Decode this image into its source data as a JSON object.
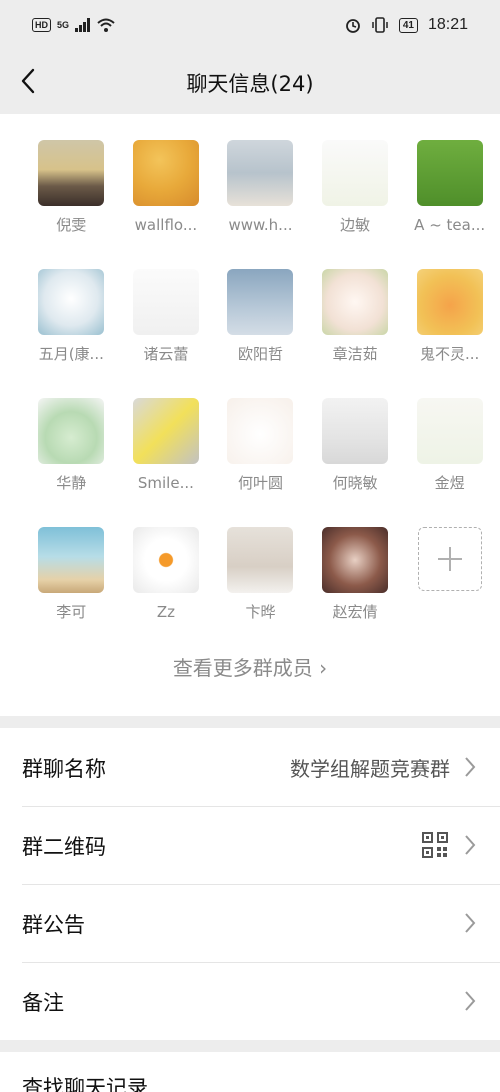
{
  "status_bar": {
    "hd": "HD",
    "network": "5G",
    "battery": "41",
    "time": "18:21"
  },
  "nav": {
    "title": "聊天信息(24)"
  },
  "members": [
    {
      "name": "倪雯",
      "avatar": "photo-window"
    },
    {
      "name": "wallflo...",
      "avatar": "little-prince"
    },
    {
      "name": "www.h...",
      "avatar": "beach-girl"
    },
    {
      "name": "边敏",
      "avatar": "sketch-girl"
    },
    {
      "name": "A ~ tea...",
      "avatar": "grass"
    },
    {
      "name": "五月(康...",
      "avatar": "cat-doll"
    },
    {
      "name": "诸云蕾",
      "avatar": "cloud-im-ok"
    },
    {
      "name": "欧阳哲",
      "avatar": "sky"
    },
    {
      "name": "章洁茹",
      "avatar": "couple-cartoon"
    },
    {
      "name": "鬼不灵...",
      "avatar": "tiger"
    },
    {
      "name": "华静",
      "avatar": "santa-cartoon"
    },
    {
      "name": "Smile...",
      "avatar": "cat-toy"
    },
    {
      "name": "何叶圆",
      "avatar": "girl-cartoon"
    },
    {
      "name": "何晓敏",
      "avatar": "child-photo"
    },
    {
      "name": "金煜",
      "avatar": "little-girl"
    },
    {
      "name": "李可",
      "avatar": "road-girl"
    },
    {
      "name": "Zz",
      "avatar": "egg"
    },
    {
      "name": "卞晔",
      "avatar": "boy-photo"
    },
    {
      "name": "赵宏倩",
      "avatar": "anime-girl"
    }
  ],
  "more_members": "查看更多群成员 ›",
  "settings": [
    {
      "label": "群聊名称",
      "value": "数学组解题竞赛群",
      "icon": "chevron-right-icon"
    },
    {
      "label": "群二维码",
      "value": "",
      "icon": "qr-code-icon"
    },
    {
      "label": "群公告",
      "value": "",
      "icon": "chevron-right-icon"
    },
    {
      "label": "备注",
      "value": "",
      "icon": "chevron-right-icon"
    }
  ],
  "partial_row": "查找聊天记录"
}
